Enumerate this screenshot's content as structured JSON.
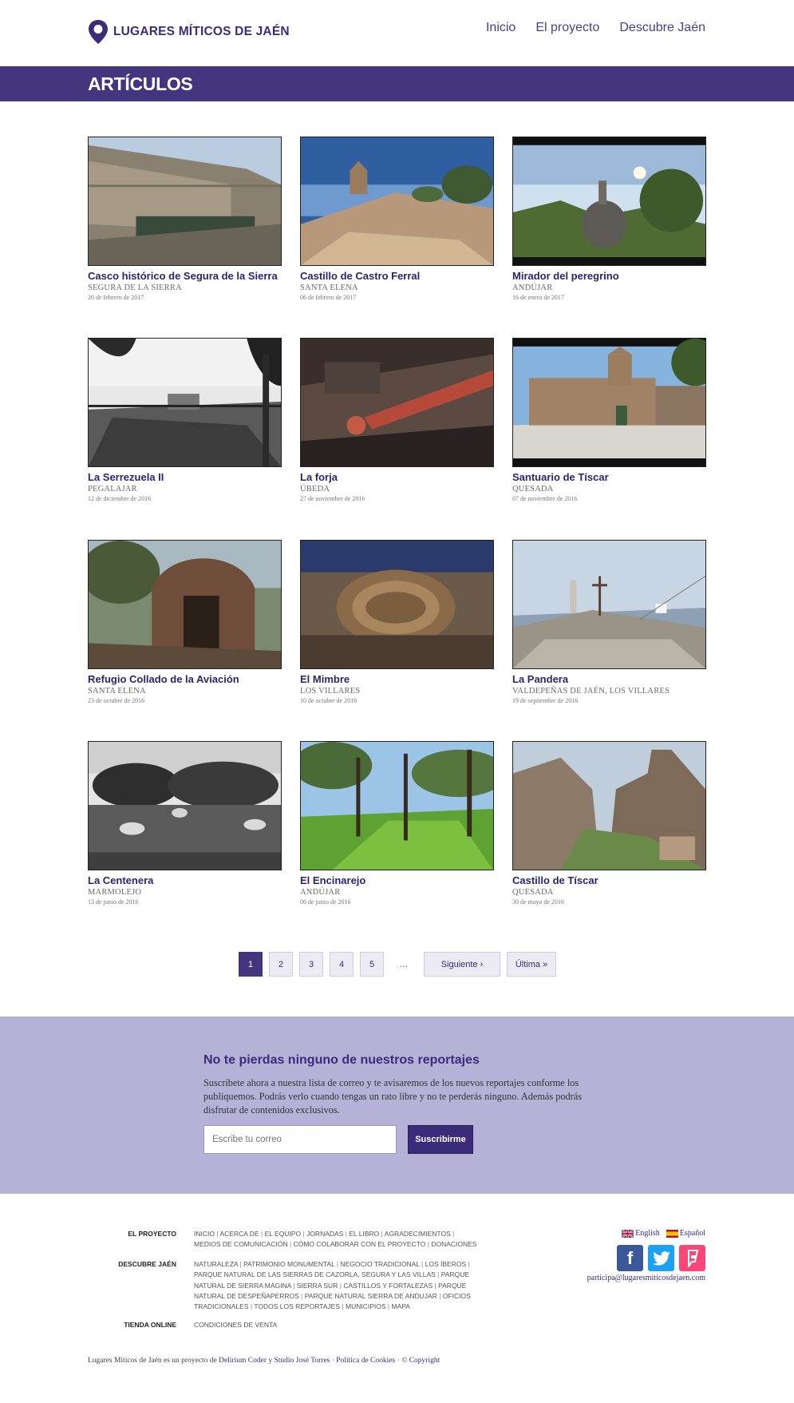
{
  "brand": {
    "name": "LUGARES MÍTICOS DE JAÉN",
    "accent": "#44357f"
  },
  "nav": [
    "Inicio",
    "El proyecto",
    "Descubre Jaén"
  ],
  "page_title": "ARTÍCULOS",
  "articles": [
    {
      "title": "Casco histórico de Segura de la Sierra",
      "location": "SEGURA DE LA SIERRA",
      "date": "20 de febrero de 2017"
    },
    {
      "title": "Castillo de Castro Ferral",
      "location": "SANTA ELENA",
      "date": "06 de febrero de 2017"
    },
    {
      "title": "Mirador del peregrino",
      "location": "ANDÚJAR",
      "date": "16 de enero de 2017"
    },
    {
      "title": "La Serrezuela II",
      "location": "PEGALAJAR",
      "date": "12 de diciembre de 2016"
    },
    {
      "title": "La forja",
      "location": "ÚBEDA",
      "date": "27 de noviembre de 2016"
    },
    {
      "title": "Santuario de Tíscar",
      "location": "QUESADA",
      "date": "07 de noviembre de 2016"
    },
    {
      "title": "Refugio Collado de la Aviación",
      "location": "SANTA ELENA",
      "date": "23 de octubre de 2016"
    },
    {
      "title": "El Mimbre",
      "location": "LOS VILLARES",
      "date": "10 de octubre de 2016"
    },
    {
      "title": "La Pandera",
      "location": "VALDEPEÑAS DE JAÉN, LOS VILLARES",
      "date": "19 de septiembre de 2016"
    },
    {
      "title": "La Centenera",
      "location": "MARMOLEJO",
      "date": "13 de junio de 2016"
    },
    {
      "title": "El Encinarejo",
      "location": "ANDÚJAR",
      "date": "06 de junio de 2016"
    },
    {
      "title": "Castillo de Tíscar",
      "location": "QUESADA",
      "date": "30 de mayo de 2016"
    }
  ],
  "pagination": {
    "pages": [
      "1",
      "2",
      "3",
      "4",
      "5"
    ],
    "dots": "…",
    "next": "Siguiente ›",
    "last": "Última »"
  },
  "newsletter": {
    "title": "No te pierdas ninguno de nuestros reportajes",
    "text": "Suscríbete ahora a nuestra lista de correo y te avisaremos de los nuevos reportajes conforme los publiquemos. Podrás verlo cuando tengas un rato libre y no te perderás ninguno. Además podrás disfrutar de contenidos exclusivos.",
    "placeholder": "Escribe tu correo",
    "button": "Suscribirme"
  },
  "footer": {
    "sections": [
      {
        "label": "EL PROYECTO",
        "links": [
          "INICIO",
          "ACERCA DE",
          "EL EQUIPO",
          "JORNADAS",
          "EL LIBRO",
          "AGRADECIMIENTOS",
          "MEDIOS DE COMUNICACIÓN",
          "CÓMO COLABORAR CON EL PROYECTO",
          "DONACIONES"
        ]
      },
      {
        "label": "DESCUBRE JAÉN",
        "links": [
          "NATURALEZA",
          "PATRIMONIO MONUMENTAL",
          "NEGOCIO TRADICIONAL",
          "LOS ÍBEROS",
          "PARQUE NATURAL DE LAS SIERRAS DE CAZORLA, SEGURA Y LAS VILLAS",
          "PARQUE NATURAL DE SIERRA MÁGINA",
          "SIERRA SUR",
          "CASTILLOS Y FORTALEZAS",
          "PARQUE NATURAL DE DESPEÑAPERROS",
          "PARQUE NATURAL SIERRA DE ANDUJAR",
          "OFICIOS TRADICIONALES",
          "TODOS LOS REPORTAJES",
          "MUNICIPIOS",
          "MAPA"
        ]
      },
      {
        "label": "TIENDA ONLINE",
        "links": [
          "CONDICIONES DE VENTA"
        ]
      }
    ],
    "languages": [
      "English",
      "Español"
    ],
    "social_icons": [
      "facebook-icon",
      "twitter-icon",
      "foursquare-icon"
    ],
    "email": "participa@lugaresmiticosdejaen.com",
    "bottom": {
      "prefix": "Lugares Míticos de Jaén es un proyecto de",
      "link1": "Delirium Coder",
      "and": "y",
      "link2": "Studio José Torres",
      "sep1": "·",
      "cookies": "Política de Cookies",
      "sep2": "·",
      "copyright": "© Copyright"
    }
  }
}
